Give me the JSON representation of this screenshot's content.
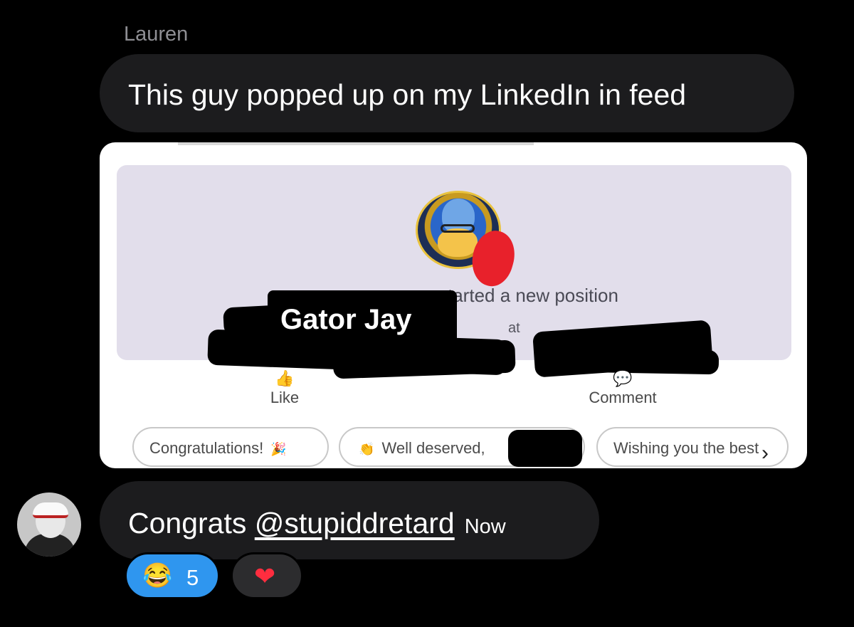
{
  "thread": {
    "sender_name": "Lauren",
    "message_1": "This guy popped up on my LinkedIn in feed",
    "message_2": {
      "prefix": "Congrats ",
      "mention": "@stupiddretard",
      "timestamp": "Now"
    }
  },
  "embedded_screenshot": {
    "overlay_name": "Gator Jay",
    "status_text": "started a new position",
    "at_text": "at",
    "like_label": "Like",
    "comment_label": "Comment",
    "like_icon": "👍",
    "comment_icon": "💬",
    "chips": [
      {
        "label": "Congratulations!",
        "emoji": "🎉"
      },
      {
        "label": "Well deserved,",
        "emoji": "👏"
      },
      {
        "label": "Wishing you the best",
        "emoji": ""
      }
    ],
    "chevron": "›"
  },
  "reactions": [
    {
      "emoji": "😂",
      "count": "5",
      "color": "#2f96ef"
    },
    {
      "emoji": "❤",
      "count": "",
      "color": "#2c2c2e"
    }
  ],
  "colors": {
    "background": "#000000",
    "bubble": "#1c1c1e",
    "sender_name": "#8e8e93",
    "banner": "#e2deeb",
    "redaction_mark": "#e8212b"
  }
}
